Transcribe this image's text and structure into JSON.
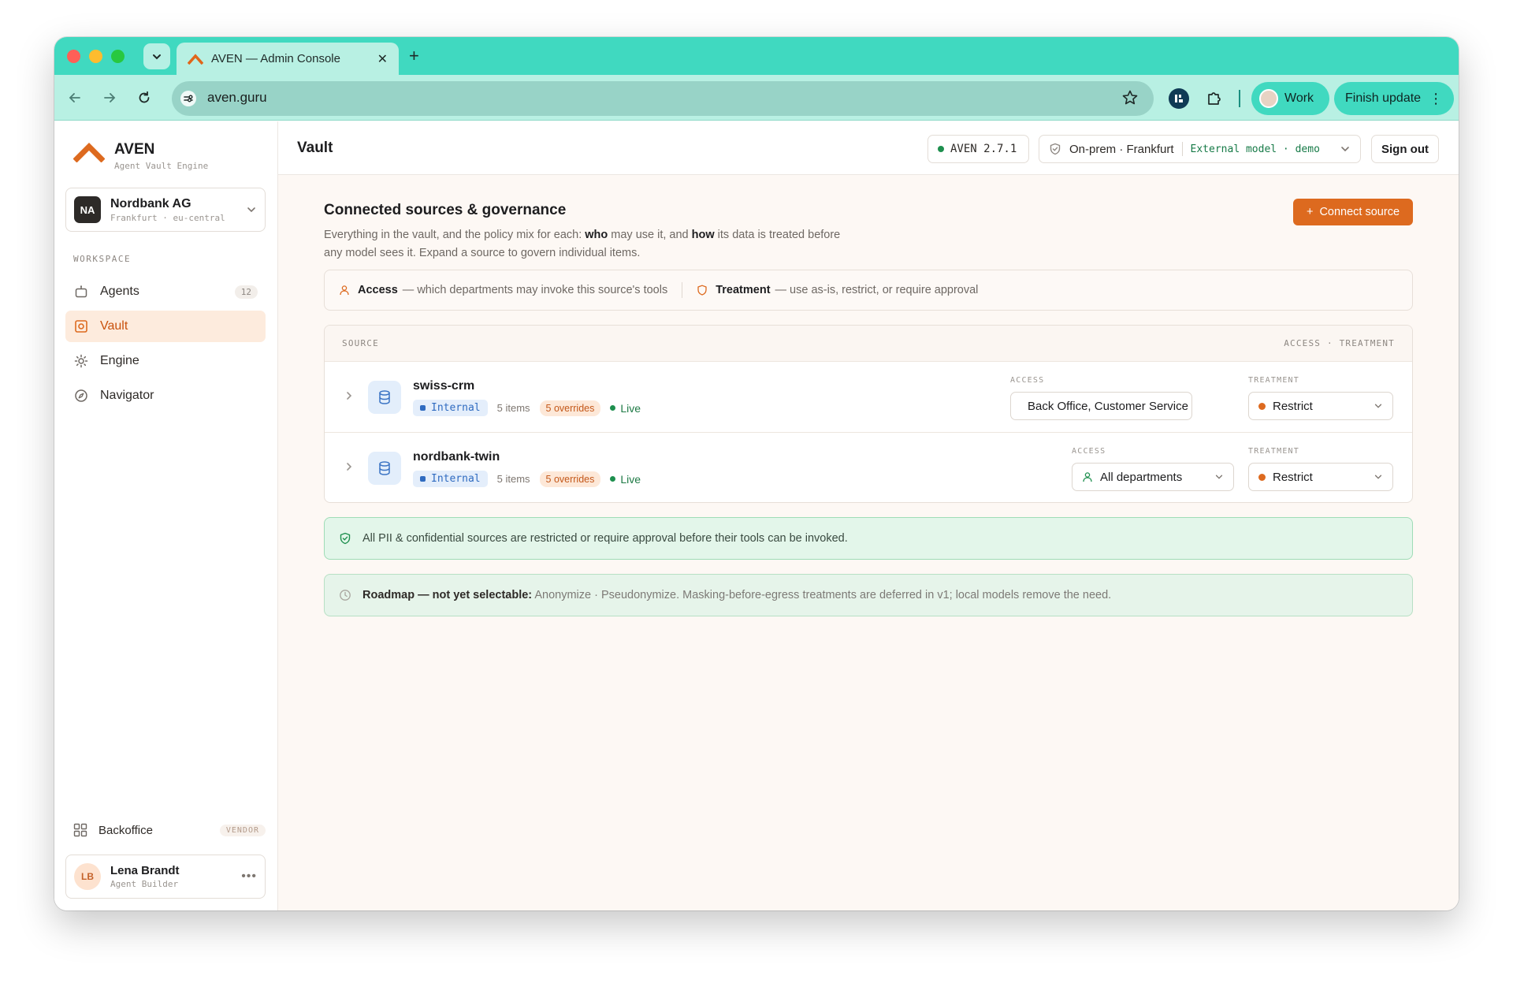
{
  "browser": {
    "tab_title": "AVEN — Admin Console",
    "new_tab": "+",
    "close": "✕",
    "url": "aven.guru",
    "profile": "Work",
    "update_button": "Finish update",
    "accent": "#40d9c0"
  },
  "sidebar": {
    "brand_title": "AVEN",
    "brand_subtitle": "Agent Vault Engine",
    "org": {
      "initials": "NA",
      "name": "Nordbank AG",
      "location": "Frankfurt · eu-central"
    },
    "section_label": "WORKSPACE",
    "items": [
      {
        "label": "Agents",
        "count": "12",
        "icon": "robot-icon"
      },
      {
        "label": "Vault",
        "icon": "vault-icon",
        "active": true
      },
      {
        "label": "Engine",
        "icon": "sun-gear-icon"
      },
      {
        "label": "Navigator",
        "icon": "compass-icon"
      }
    ],
    "backoffice_label": "Backoffice",
    "vendor_badge": "VENDOR",
    "user": {
      "initials": "LB",
      "name": "Lena Brandt",
      "role": "Agent Builder",
      "more": "•••"
    }
  },
  "header": {
    "title": "Vault",
    "version": "AVEN 2.7.1",
    "deployment": "On-prem · Frankfurt",
    "model": "External model · demo",
    "sign_out": "Sign out"
  },
  "content": {
    "title": "Connected sources & governance",
    "desc_1": "Everything in the vault, and the policy mix for each: ",
    "desc_who": "who",
    "desc_2": " may use it, and ",
    "desc_how": "how",
    "desc_3": " its data is treated before any model sees it. Expand a source to govern individual items.",
    "connect_button": "Connect source",
    "connect_plus": "+",
    "legend": {
      "access_title": "Access",
      "access_text": "— which departments may invoke this source's tools",
      "treatment_title": "Treatment",
      "treatment_text": "— use as-is, restrict, or require approval"
    },
    "table": {
      "col_source": "SOURCE",
      "col_policy": "ACCESS · TREATMENT",
      "access_label": "ACCESS",
      "treatment_label": "TREATMENT",
      "rows": [
        {
          "name": "swiss-crm",
          "tag": "Internal",
          "items": "5 items",
          "overrides": "5 overrides",
          "status": "Live",
          "access": "Back Office, Customer Service",
          "treatment": "Restrict"
        },
        {
          "name": "nordbank-twin",
          "tag": "Internal",
          "items": "5 items",
          "overrides": "5 overrides",
          "status": "Live",
          "access": "All departments",
          "treatment": "Restrict"
        }
      ]
    },
    "notice_ok": "All PII & confidential sources are restricted or require approval before their tools can be invoked.",
    "roadmap_title": "Roadmap — not yet selectable:",
    "roadmap_text": " Anonymize · Pseudonymize. Masking-before-egress treatments are deferred in v1; local models remove the need."
  }
}
